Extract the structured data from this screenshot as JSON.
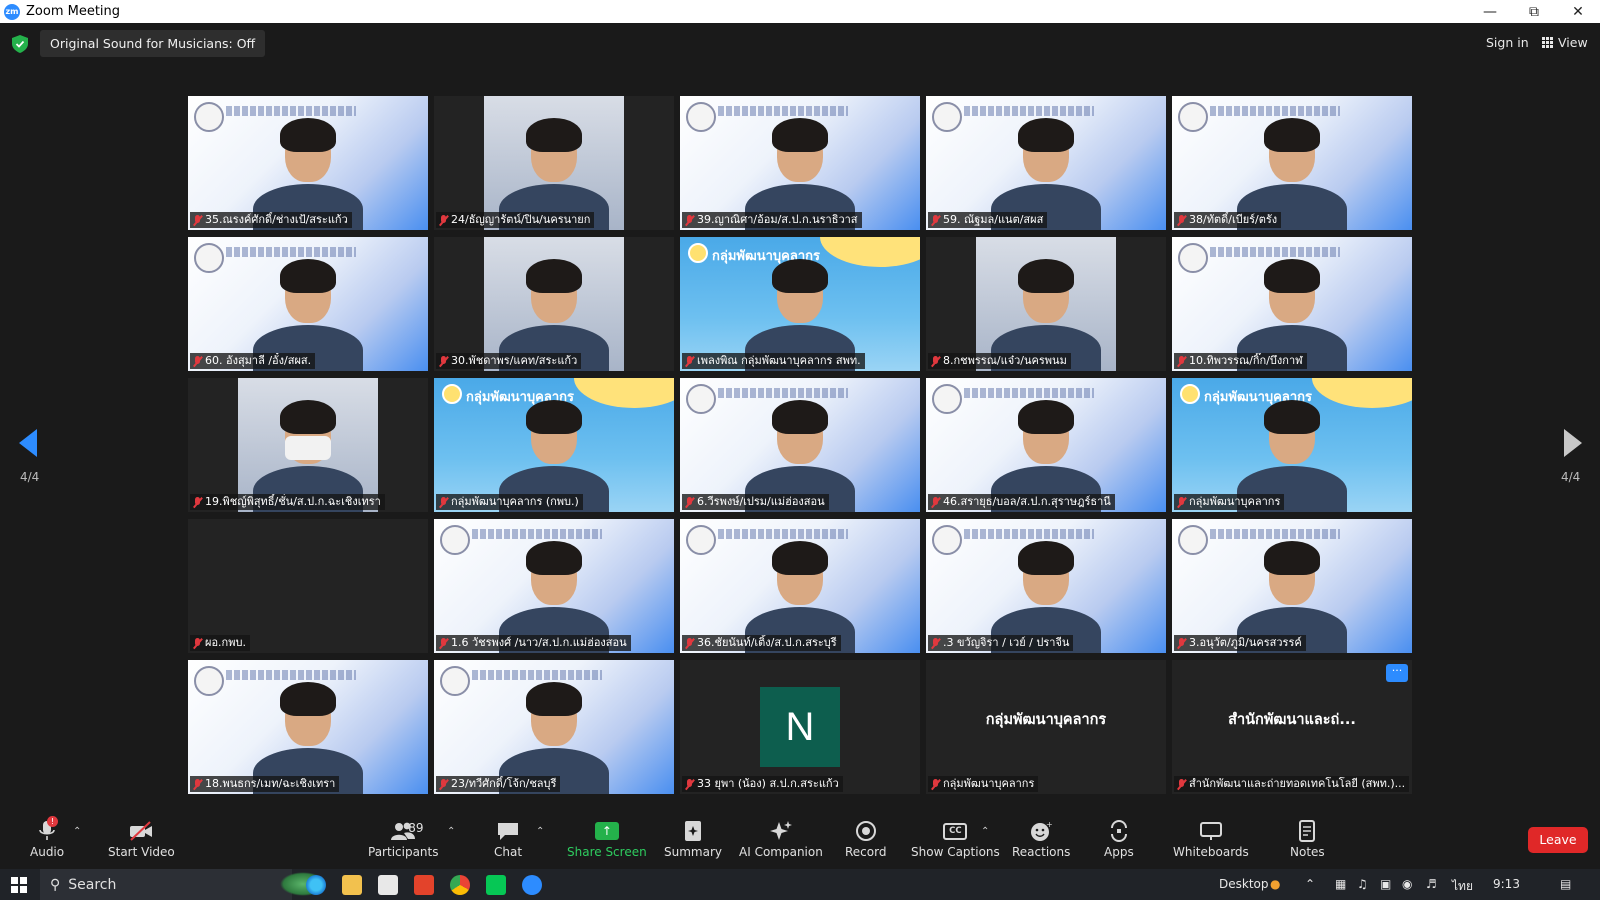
{
  "window": {
    "title": "Zoom Meeting",
    "logo_text": "zm"
  },
  "topbar": {
    "original_sound": "Original Sound for Musicians: Off",
    "sign_in": "Sign in",
    "view": "View"
  },
  "pagination": {
    "left": "4/4",
    "right": "4/4"
  },
  "tiles": [
    {
      "name": "35.ณรงค์ศักดิ์/ช่างเป้/สระแก้ว",
      "bg": "slide-cam"
    },
    {
      "name": "24/ธัญญารัตน์/ปิน/นครนายก",
      "bg": "plain-cam"
    },
    {
      "name": "39.ญาณิศา/อ้อม/ส.ป.ก.นราธิวาส",
      "bg": "slide"
    },
    {
      "name": "59. ณัฐมล/แนต/สผส",
      "bg": "slide"
    },
    {
      "name": "38/ทัตดิ์/เบียร์/ตรัง",
      "bg": "slide"
    },
    {
      "name": "60. อังสุมาลี /อั๋ง/สผส.",
      "bg": "slide"
    },
    {
      "name": "30.พัชดาพร/แคท/สระแก้ว",
      "bg": "plain-cam"
    },
    {
      "name": "เพลงพิณ กลุ่มพัฒนาบุคลากร สพท.",
      "bg": "group"
    },
    {
      "name": "8.กชพรรณ/แจ๋ว/นครพนม",
      "bg": "plain-cam"
    },
    {
      "name": "10.ทิพวรรณ/กิ๊ก/บึงกาฬ",
      "bg": "slide"
    },
    {
      "name": "19.พิชญ์พิสุทธิ์/ชั่น/ส.ป.ก.ฉะเชิงเทรา",
      "bg": "plain-cam"
    },
    {
      "name": "กลุ่มพัฒนาบุคลากร (กพบ.)",
      "bg": "group"
    },
    {
      "name": "6.วีรพงษ์/เปรม/แม่ฮ่องสอน",
      "bg": "slide"
    },
    {
      "name": "46.สรายุธ/บอล/ส.ป.ก.สุราษฎร์ธานี",
      "bg": "slide"
    },
    {
      "name": "กลุ่มพัฒนาบุคลากร",
      "bg": "group"
    },
    {
      "name": "ผอ.กพบ.",
      "bg": "empty"
    },
    {
      "name": "1.6 วัชรพงศ์ /นาว/ส.ป.ก.แม่ฮ่องสอน",
      "bg": "slide"
    },
    {
      "name": "36.ชัยนันท์/เติ้ง/ส.ป.ก.สระบุรี",
      "bg": "slide"
    },
    {
      "name": ".3 ขวัญจิรา / เวย์ / ปราจีน",
      "bg": "slide"
    },
    {
      "name": "3.อนุวัต/ภูมิ/นครสวรรค์",
      "bg": "slide"
    },
    {
      "name": "18.พนธกร/เมท/ฉะเชิงเทรา",
      "bg": "slide"
    },
    {
      "name": "23/ทวีศักดิ์/โจ้ก/ชลบุรี",
      "bg": "slide"
    },
    {
      "name": "33 ยุพา (น้อง) ส.ป.ก.สระแก้ว",
      "bg": "avatar",
      "avatar": "N"
    },
    {
      "name": "กลุ่มพัฒนาบุคลากร",
      "bg": "textonly",
      "center": "กลุ่มพัฒนาบุคลากร"
    },
    {
      "name": "สำนักพัฒนาและถ่ายทอดเทคโนโลยี (สพท.)...",
      "bg": "textonly",
      "center": "สำนักพัฒนาและถ่...",
      "more": "···"
    }
  ],
  "group_bg_title": "กลุ่มพัฒนาบุคลากร",
  "toolbar": {
    "audio": "Audio",
    "audio_badge": "!",
    "start_video": "Start Video",
    "participants": "Participants",
    "participants_count": "89",
    "chat": "Chat",
    "share_screen": "Share Screen",
    "summary": "Summary",
    "ai_companion": "AI Companion",
    "record": "Record",
    "show_captions": "Show Captions",
    "cc": "CC",
    "reactions": "Reactions",
    "apps": "Apps",
    "whiteboards": "Whiteboards",
    "notes": "Notes",
    "leave": "Leave"
  },
  "taskbar": {
    "search": "Search",
    "desktop": "Desktop",
    "lang": "ไทย",
    "time": "9:13"
  },
  "colors": {
    "accent": "#2d8cff",
    "leave": "#e02828",
    "share": "#24b14b",
    "muted_mic": "#e0383e"
  }
}
